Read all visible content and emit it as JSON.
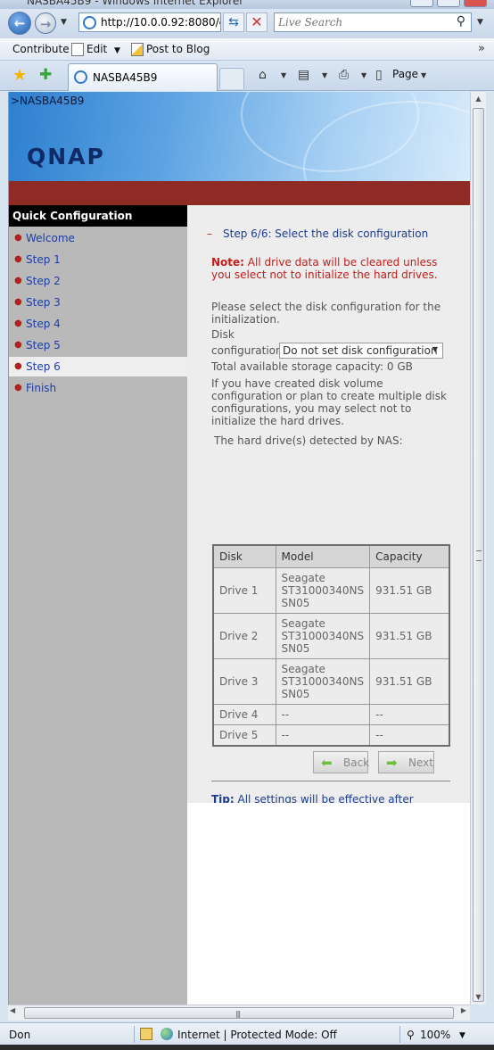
{
  "browser": {
    "window_title": "NASBA45B9 - Windows Internet Explorer",
    "address": "http://10.0.0.92:8080/c",
    "search_placeholder": "Live Search",
    "links": {
      "contribute": "Contribute",
      "edit": "Edit",
      "post_to_blog": "Post to Blog"
    },
    "tab_title": "NASBA45B9",
    "page_menu": "Page",
    "status_text": "Don",
    "zone_text": "Internet | Protected Mode: Off",
    "zoom": "100%"
  },
  "page": {
    "breadcrumb": ">NASBA45B9",
    "logo": "QNAP",
    "sidebar": {
      "heading": "Quick Configuration",
      "items": [
        {
          "label": "Welcome"
        },
        {
          "label": "Step 1"
        },
        {
          "label": "Step 2"
        },
        {
          "label": "Step 3"
        },
        {
          "label": "Step 4"
        },
        {
          "label": "Step 5"
        },
        {
          "label": "Step 6"
        },
        {
          "label": "Finish"
        }
      ],
      "active_index": 6
    },
    "main": {
      "step_title": "Step 6/6: Select the disk configuration",
      "note_label": "Note:",
      "note_text": "All drive data will be cleared unless you select not to initialize the hard drives.",
      "instruction": "Please select the disk configuration for the initialization.",
      "disk_label_1": "Disk",
      "disk_label_2": "configuration:",
      "disk_select_value": "Do not set disk configuration",
      "capacity_text": "Total available storage capacity: 0 GB",
      "init_note": "If you have created disk volume configuration or plan to create multiple disk configurations, you may select not to initialize the hard drives.",
      "detected_heading": "The hard drive(s) detected by NAS:",
      "table": {
        "headers": [
          "Disk",
          "Model",
          "Capacity"
        ],
        "rows": [
          {
            "disk": "Drive 1",
            "model_1": "Seagate",
            "model_2": "ST31000340NS",
            "model_3": "SN05",
            "capacity": "931.51 GB"
          },
          {
            "disk": "Drive 2",
            "model_1": "Seagate",
            "model_2": "ST31000340NS",
            "model_3": "SN05",
            "capacity": "931.51 GB"
          },
          {
            "disk": "Drive 3",
            "model_1": "Seagate",
            "model_2": "ST31000340NS",
            "model_3": "SN05",
            "capacity": "931.51 GB"
          },
          {
            "disk": "Drive 4",
            "model": "--",
            "capacity": "--"
          },
          {
            "disk": "Drive 5",
            "model": "--",
            "capacity": "--"
          }
        ]
      },
      "tip_label": "Tip:",
      "tip_text": "All settings will be effective after confirming the changes in the last step.",
      "back_label": "Back",
      "next_label": "Next"
    }
  },
  "colors": {
    "header_red": "#8e2b25",
    "sidebar_gray": "#b9b9b9",
    "link_blue": "#1b3ea8",
    "note_red": "#c0201c"
  }
}
